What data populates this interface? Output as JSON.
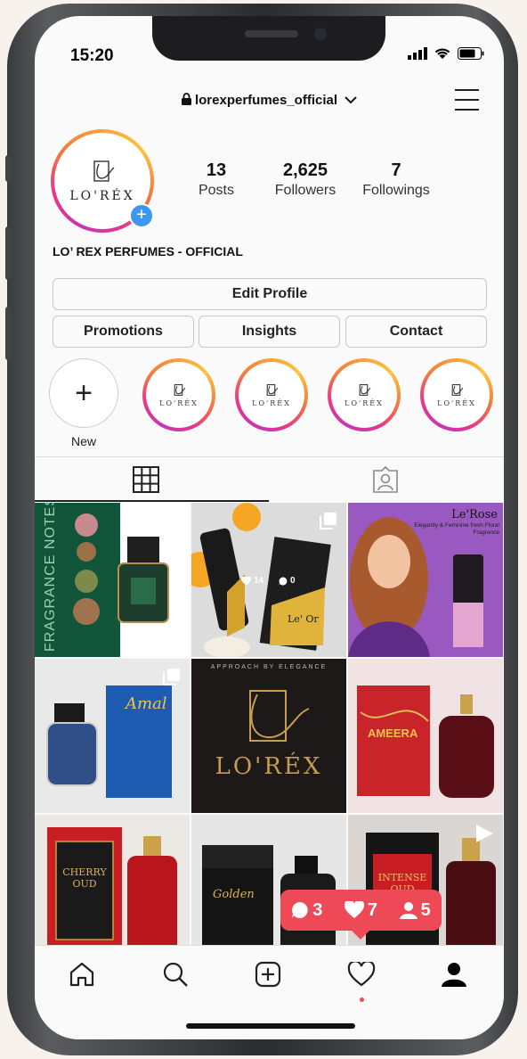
{
  "status_bar": {
    "time": "15:20"
  },
  "header": {
    "username": "lorexperfumes_official"
  },
  "profile": {
    "logo_text": "LO'RÉX",
    "display_name": "LO’ REX PERFUMES - OFFICIAL",
    "stats": [
      {
        "value": "13",
        "label": "Posts"
      },
      {
        "value": "2,625",
        "label": "Followers"
      },
      {
        "value": "7",
        "label": "Followings"
      }
    ]
  },
  "buttons": {
    "edit_profile": "Edit Profile",
    "promotions": "Promotions",
    "insights": "Insights",
    "contact": "Contact"
  },
  "highlights": {
    "new_label": "New",
    "logo_text": "LO'RÉX"
  },
  "posts": {
    "post1": {
      "label": "FRAGRANCE NOTES"
    },
    "post2": {
      "likes": "14",
      "comments": "0",
      "label": "Le' Or"
    },
    "post3": {
      "title": "Le'Rose",
      "subtitle": "Elegantly & Feminine fresh Floral Fragrance"
    },
    "post4": {
      "label": "Amal"
    },
    "post5": {
      "tagline": "APPROACH BY ELEGANCE",
      "brand": "LO'RÉX"
    },
    "post6": {
      "label": "AMEERA"
    },
    "post7": {
      "label": "CHERRY OUD"
    },
    "post8": {
      "label": "Golden"
    },
    "post9": {
      "label": "INTENSE OUD"
    }
  },
  "notification": {
    "comments": "3",
    "likes": "7",
    "follows": "5"
  },
  "colors": {
    "notification": "#ed4956",
    "badge_blue": "#3b97f1"
  }
}
